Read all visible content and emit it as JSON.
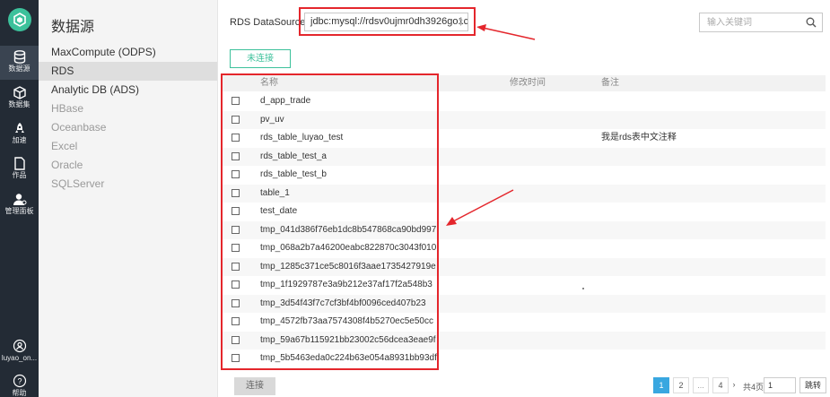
{
  "sidebar": {
    "nav": [
      {
        "label": "数据源",
        "icon": "database-icon",
        "active": true
      },
      {
        "label": "数据集",
        "icon": "cube-icon",
        "active": false
      },
      {
        "label": "加速",
        "icon": "rocket-icon",
        "active": false
      },
      {
        "label": "作品",
        "icon": "page-icon",
        "active": false
      },
      {
        "label": "管理面板",
        "icon": "user-admin-icon",
        "active": false
      }
    ],
    "user": {
      "label": "luyao_on...",
      "icon": "user-icon"
    },
    "help": {
      "label": "帮助",
      "icon": "help-icon"
    }
  },
  "source_panel": {
    "title": "数据源",
    "items": [
      {
        "label": "MaxCompute (ODPS)",
        "enabled": true
      },
      {
        "label": "RDS",
        "enabled": true,
        "selected": true
      },
      {
        "label": "Analytic DB (ADS)",
        "enabled": true
      },
      {
        "label": "HBase",
        "enabled": false
      },
      {
        "label": "Oceanbase",
        "enabled": false
      },
      {
        "label": "Excel",
        "enabled": false
      },
      {
        "label": "Oracle",
        "enabled": false
      },
      {
        "label": "SQLServer",
        "enabled": false
      }
    ]
  },
  "toolbar": {
    "datasource_label": "RDS DataSource",
    "datasource_value": "jdbc:mysql://rdsv0ujmr0dh3926go1c",
    "search_placeholder": "输入关键词",
    "connect_status_button": "未连接"
  },
  "table": {
    "columns": [
      "名称",
      "修改时间",
      "备注"
    ],
    "rows": [
      {
        "name": "d_app_trade",
        "modified": "",
        "note": ""
      },
      {
        "name": "pv_uv",
        "modified": "",
        "note": ""
      },
      {
        "name": "rds_table_luyao_test",
        "modified": "",
        "note": "我是rds表中文注释"
      },
      {
        "name": "rds_table_test_a",
        "modified": "",
        "note": ""
      },
      {
        "name": "rds_table_test_b",
        "modified": "",
        "note": ""
      },
      {
        "name": "table_1",
        "modified": "",
        "note": ""
      },
      {
        "name": "test_date",
        "modified": "",
        "note": ""
      },
      {
        "name": "tmp_041d386f76eb1dc8b547868ca90bd997",
        "modified": "",
        "note": ""
      },
      {
        "name": "tmp_068a2b7a46200eabc822870c3043f010",
        "modified": "",
        "note": ""
      },
      {
        "name": "tmp_1285c371ce5c8016f3aae1735427919e",
        "modified": "",
        "note": ""
      },
      {
        "name": "tmp_1f1929787e3a9b212e37af17f2a548b3",
        "modified": "",
        "note": ""
      },
      {
        "name": "tmp_3d54f43f7c7cf3bf4bf0096ced407b23",
        "modified": "",
        "note": ""
      },
      {
        "name": "tmp_4572fb73aa7574308f4b5270ec5e50cc",
        "modified": "",
        "note": ""
      },
      {
        "name": "tmp_59a67b115921bb23002c56dcea3eae9f",
        "modified": "",
        "note": ""
      },
      {
        "name": "tmp_5b5463eda0c224b63e054a8931bb93df",
        "modified": "",
        "note": ""
      }
    ]
  },
  "footer": {
    "connect_button": "连接",
    "pages": [
      "1",
      "2",
      "...",
      "4"
    ],
    "current_page": "1",
    "next_symbol": "›",
    "total_pages_text": "共4页",
    "jump_input_value": "1",
    "jump_button": "跳转"
  },
  "colors": {
    "rail_bg": "#232b35",
    "accent_green": "#3cc19b",
    "annotation_red": "#e4262c",
    "pagination_active": "#39a7e0"
  }
}
